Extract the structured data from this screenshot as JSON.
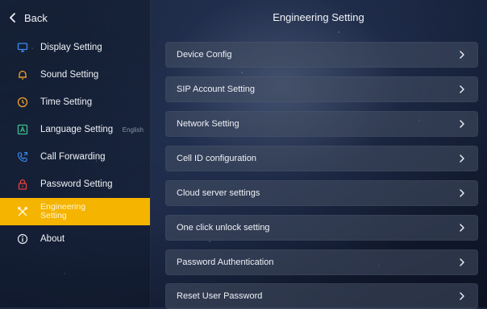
{
  "header": {
    "back_label": "Back",
    "title": "Engineering Setting"
  },
  "sidebar": {
    "items": [
      {
        "label": "Display Setting",
        "icon": "display-icon",
        "sub": ""
      },
      {
        "label": "Sound Setting",
        "icon": "bell-icon",
        "sub": ""
      },
      {
        "label": "Time Setting",
        "icon": "clock-icon",
        "sub": ""
      },
      {
        "label": "Language Setting",
        "icon": "language-icon",
        "sub": "English"
      },
      {
        "label": "Call Forwarding",
        "icon": "phone-forward-icon",
        "sub": ""
      },
      {
        "label": "Password Setting",
        "icon": "lock-icon",
        "sub": ""
      },
      {
        "label": "Engineering Setting",
        "icon": "tools-icon",
        "sub": "",
        "active": true
      },
      {
        "label": "About",
        "icon": "info-icon",
        "sub": ""
      }
    ]
  },
  "settings": {
    "items": [
      {
        "label": "Device Config"
      },
      {
        "label": "SIP Account Setting"
      },
      {
        "label": "Network Setting"
      },
      {
        "label": "Cell ID configuration"
      },
      {
        "label": "Cloud server settings"
      },
      {
        "label": "One click unlock setting"
      },
      {
        "label": "Password Authentication"
      },
      {
        "label": "Reset User Password"
      }
    ]
  },
  "colors": {
    "accent": "#f4b400",
    "icon_blue": "#3d8bf0",
    "icon_orange": "#f2a02d",
    "icon_green": "#3fbf8f",
    "icon_red": "#e8413c",
    "icon_teal": "#37b6c9"
  }
}
